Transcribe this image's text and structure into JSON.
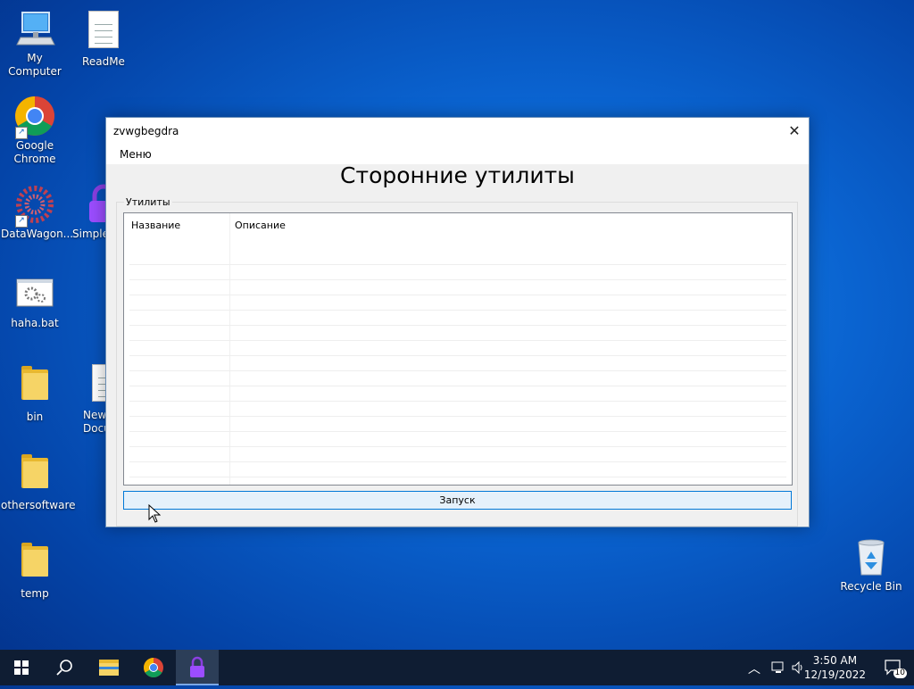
{
  "desktop": {
    "icons": [
      {
        "label": "My Computer"
      },
      {
        "label": "ReadMe"
      },
      {
        "label": "Google Chrome"
      },
      {
        "label": "DataWagon..."
      },
      {
        "label": "Simple"
      },
      {
        "label": "haha.bat"
      },
      {
        "label": "bin"
      },
      {
        "label": "New Docu"
      },
      {
        "label": "othersoftware"
      },
      {
        "label": "temp"
      },
      {
        "label": "Recycle Bin"
      }
    ]
  },
  "window": {
    "title": "zvwgbegdra",
    "close_glyph": "✕",
    "menu_label": "Меню",
    "heading": "Сторонние утилиты",
    "group_label": "Утилиты",
    "columns": [
      "Название",
      "Описание"
    ],
    "rows": [],
    "run_button": "Запуск"
  },
  "taskbar": {
    "time": "3:50 AM",
    "date": "12/19/2022",
    "notification_count": "10",
    "apps": [
      "start-icon",
      "search-icon",
      "file-explorer-icon",
      "chrome-icon",
      "lock-app-icon"
    ]
  }
}
